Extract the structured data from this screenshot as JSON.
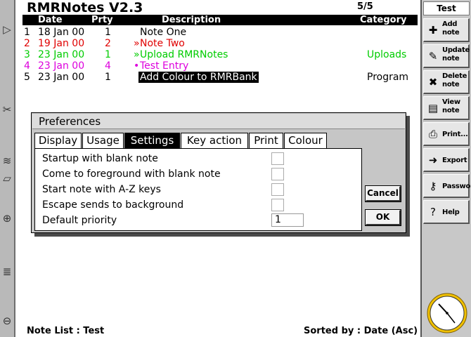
{
  "app": {
    "title": "RMRNotes V2.3",
    "page_count": "5/5"
  },
  "columns": {
    "date": "Date",
    "prty": "Prty",
    "description": "Description",
    "category": "Category"
  },
  "notes": [
    {
      "num": "1",
      "date": "18 Jan 00",
      "prty": "1",
      "mark": "",
      "description": "Note One",
      "category": "",
      "color": "#000000",
      "highlight": false
    },
    {
      "num": "2",
      "date": "19 Jan 00",
      "prty": "2",
      "mark": "»",
      "description": "Note Two",
      "category": "",
      "color": "#e00000",
      "highlight": false
    },
    {
      "num": "3",
      "date": "23 Jan 00",
      "prty": "1",
      "mark": "»",
      "description": "Upload RMRNotes",
      "category": "Uploads",
      "color": "#00cc00",
      "highlight": false
    },
    {
      "num": "4",
      "date": "23 Jan 00",
      "prty": "4",
      "mark": "•",
      "description": "Test Entry",
      "category": "",
      "color": "#dd00dd",
      "highlight": false
    },
    {
      "num": "5",
      "date": "23 Jan 00",
      "prty": "1",
      "mark": "",
      "description": "Add Colour to RMRBank",
      "category": "Program",
      "color": "#000000",
      "highlight": true
    }
  ],
  "sidebar": {
    "title": "Test",
    "buttons": [
      {
        "line1": "Add",
        "line2": "note",
        "icon": "add-note-icon",
        "glyph": "✚"
      },
      {
        "line1": "Update",
        "line2": "note",
        "icon": "update-note-icon",
        "glyph": "✎"
      },
      {
        "line1": "Delete",
        "line2": "note",
        "icon": "delete-note-icon",
        "glyph": "✖"
      },
      {
        "line1": "View",
        "line2": "note",
        "icon": "view-note-icon",
        "glyph": "▤"
      },
      {
        "line1": "Print...",
        "line2": "",
        "icon": "printer-icon",
        "glyph": "⎙"
      },
      {
        "line1": "Export",
        "line2": "",
        "icon": "export-icon",
        "glyph": "➜"
      },
      {
        "line1": "Passwo",
        "line2": "",
        "icon": "key-icon",
        "glyph": "⚷"
      },
      {
        "line1": "Help",
        "line2": "",
        "icon": "help-icon",
        "glyph": "?"
      }
    ]
  },
  "footer": {
    "left": "Note List : Test",
    "right": "Sorted by : Date (Asc)"
  },
  "dialog": {
    "title": "Preferences",
    "tabs": [
      "Display",
      "Usage",
      "Settings",
      "Key action",
      "Print",
      "Colour"
    ],
    "active_tab": "Settings",
    "options": [
      {
        "label": "Startup with blank note",
        "checked": false
      },
      {
        "label": "Come to foreground with blank note",
        "checked": false
      },
      {
        "label": "Start note with A-Z keys",
        "checked": false
      },
      {
        "label": "Escape sends to background",
        "checked": false
      }
    ],
    "priority_label": "Default priority",
    "priority_value": "1",
    "cancel_label": "Cancel",
    "ok_label": "OK"
  },
  "colors": {
    "accent": "#000000",
    "dialog_bg": "#c6c6c6",
    "sidebar_bg": "#c8c8c8"
  }
}
